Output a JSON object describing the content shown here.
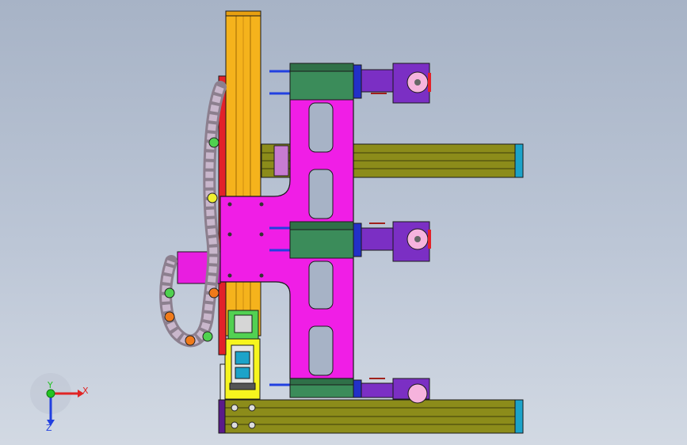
{
  "viewport": {
    "background_top": "#a7b3c6",
    "background_bottom": "#d2d9e3"
  },
  "colors": {
    "vertical_rail": "#f5b31c",
    "carriage_plate": "#f01ee6",
    "horizontal_rail": "#8c8c1a",
    "rail_end_cap": "#1ca3c9",
    "gripper_block": "#3b8c5a",
    "gripper_bracket": "#7b2fc4",
    "roller": "#f6b3dd",
    "motor_block": "#e81ee0",
    "base_block": "#f7f51e",
    "cable_chain": "#9b8fa0",
    "edge": "#1a1a1a"
  },
  "triad": {
    "x_label": "X",
    "y_label": "Y",
    "z_label": "Z",
    "x_color": "#e02424",
    "y_color": "#22c422",
    "z_color": "#2240e0"
  },
  "icons": {
    "triad": "xyz-axis-triad-icon",
    "chain": "cable-drag-chain-icon"
  }
}
